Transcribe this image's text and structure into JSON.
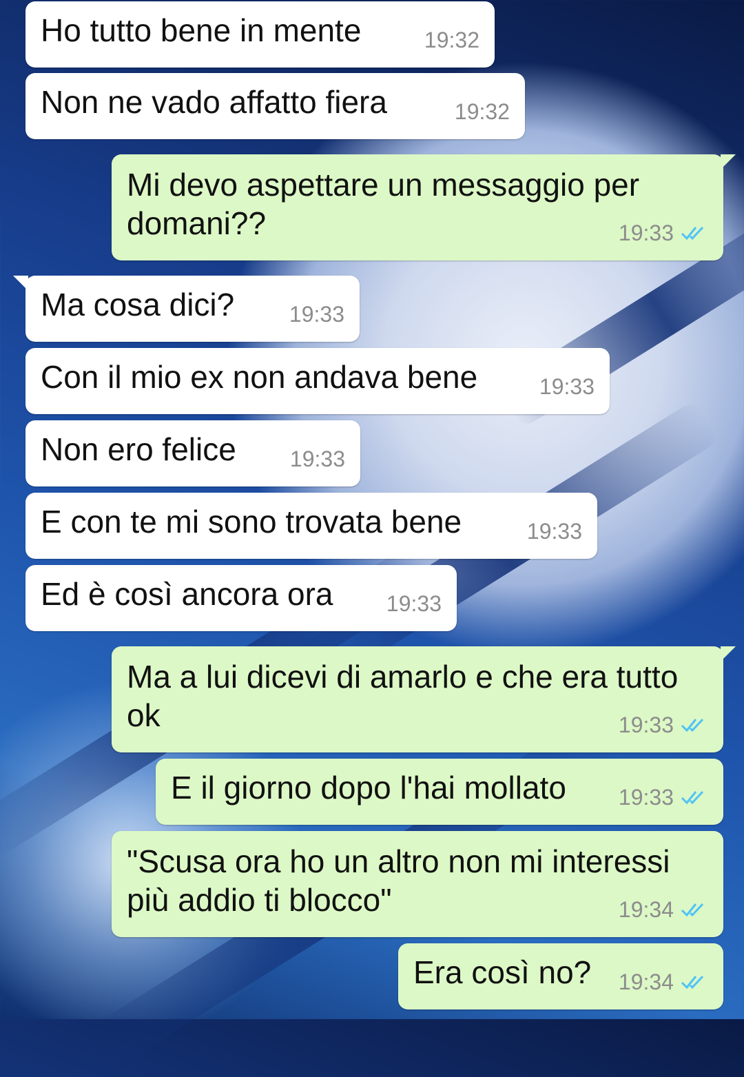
{
  "chat": {
    "messages": [
      {
        "direction": "in",
        "text": "Ho tutto bene in mente",
        "time": "19:32"
      },
      {
        "direction": "in",
        "text": "Non ne vado affatto fiera",
        "time": "19:32"
      },
      {
        "direction": "out",
        "text": "Mi devo aspettare un messaggio per domani??",
        "time": "19:33",
        "status": "read-double-check-icon"
      },
      {
        "direction": "in",
        "text": "Ma cosa dici?",
        "time": "19:33"
      },
      {
        "direction": "in",
        "text": "Con il mio ex non andava bene",
        "time": "19:33"
      },
      {
        "direction": "in",
        "text": "Non ero felice",
        "time": "19:33"
      },
      {
        "direction": "in",
        "text": "E con te mi sono trovata bene",
        "time": "19:33"
      },
      {
        "direction": "in",
        "text": "Ed è così ancora ora",
        "time": "19:33"
      },
      {
        "direction": "out",
        "text": "Ma a lui dicevi di amarlo e che era tutto ok",
        "time": "19:33",
        "status": "read-double-check-icon"
      },
      {
        "direction": "out",
        "text": "E il giorno dopo l'hai mollato",
        "time": "19:33",
        "status": "read-double-check-icon"
      },
      {
        "direction": "out",
        "text": "\"Scusa ora ho un altro non mi interessi più addio ti blocco\"",
        "time": "19:34",
        "status": "read-double-check-icon"
      },
      {
        "direction": "out",
        "text": "Era così no?",
        "time": "19:34",
        "status": "read-double-check-icon"
      }
    ]
  },
  "colors": {
    "incoming_bubble": "#ffffff",
    "outgoing_bubble": "#dcf8c6",
    "read_ticks": "#4fc3f7",
    "timestamp": "#8c8c8c"
  }
}
